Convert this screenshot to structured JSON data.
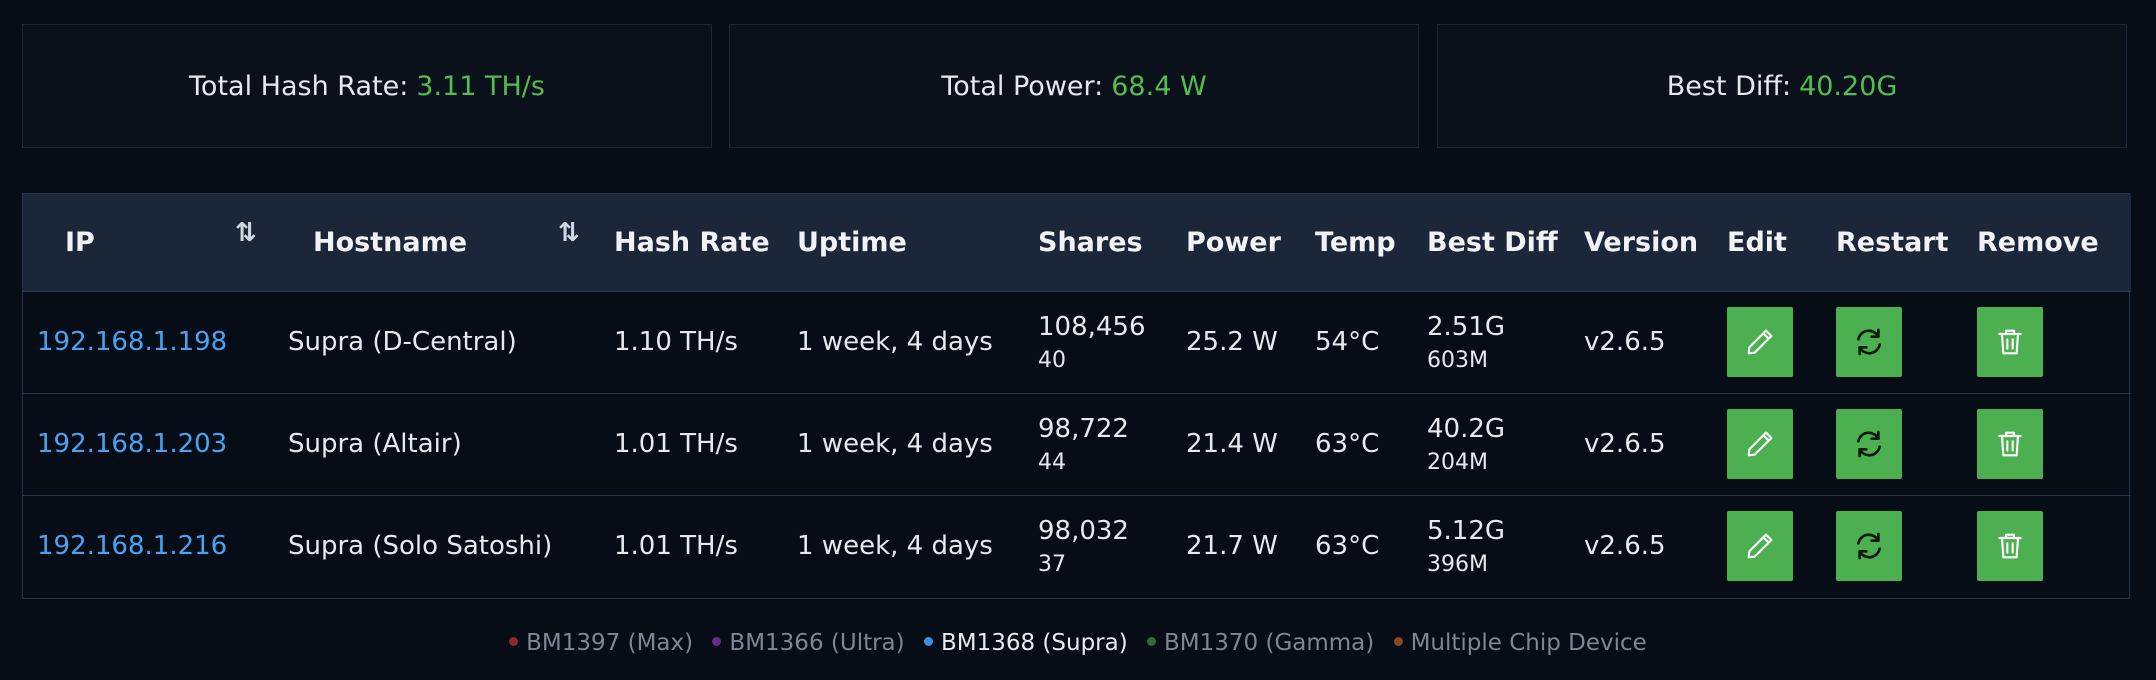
{
  "summary": {
    "hash_rate_label": "Total Hash Rate:",
    "hash_rate_value": "3.11 TH/s",
    "power_label": "Total Power:",
    "power_value": "68.4 W",
    "best_diff_label": "Best Diff:",
    "best_diff_value": "40.20G"
  },
  "table": {
    "headers": {
      "ip": "IP",
      "hostname": "Hostname",
      "hash_rate": "Hash Rate",
      "uptime": "Uptime",
      "shares": "Shares",
      "power": "Power",
      "temp": "Temp",
      "best_diff": "Best Diff",
      "version": "Version",
      "edit": "Edit",
      "restart": "Restart",
      "remove": "Remove"
    },
    "sort_glyph": "⇅",
    "rows": [
      {
        "ip": "192.168.1.198",
        "hostname": "Supra (D-Central)",
        "hash_rate": "1.10 TH/s",
        "uptime": "1 week, 4 days",
        "shares_accepted": "108,456",
        "shares_rejected": "40",
        "power": "25.2 W",
        "temp": "54°C",
        "best_diff": "2.51G",
        "session_diff": "603M",
        "version": "v2.6.5"
      },
      {
        "ip": "192.168.1.203",
        "hostname": "Supra (Altair)",
        "hash_rate": "1.01 TH/s",
        "uptime": "1 week, 4 days",
        "shares_accepted": "98,722",
        "shares_rejected": "44",
        "power": "21.4 W",
        "temp": "63°C",
        "best_diff": "40.2G",
        "session_diff": "204M",
        "version": "v2.6.5"
      },
      {
        "ip": "192.168.1.216",
        "hostname": "Supra (Solo Satoshi)",
        "hash_rate": "1.01 TH/s",
        "uptime": "1 week, 4 days",
        "shares_accepted": "98,032",
        "shares_rejected": "37",
        "power": "21.7 W",
        "temp": "63°C",
        "best_diff": "5.12G",
        "session_diff": "396M",
        "version": "v2.6.5"
      }
    ]
  },
  "legend": [
    {
      "label": "BM1397 (Max)",
      "color": "#8b2a2a",
      "active": false
    },
    {
      "label": "BM1366 (Ultra)",
      "color": "#6a2a8a",
      "active": false
    },
    {
      "label": "BM1368 (Supra)",
      "color": "#3b8fe0",
      "active": true
    },
    {
      "label": "BM1370 (Gamma)",
      "color": "#2f6b35",
      "active": false
    },
    {
      "label": "Multiple Chip Device",
      "color": "#8a4a1f",
      "active": false
    }
  ],
  "colors": {
    "accent_green": "#4caf50",
    "value_green": "#53bd50",
    "link_blue": "#4aa3f0",
    "background": "#070d16",
    "header_bg": "#1b2638"
  }
}
